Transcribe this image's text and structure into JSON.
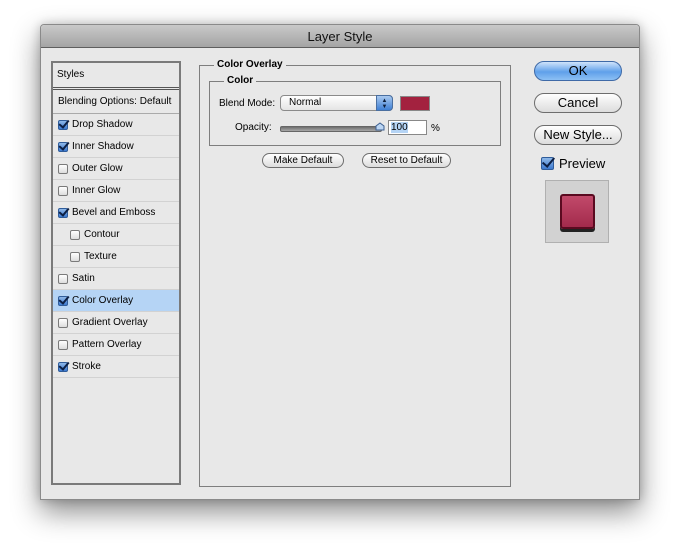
{
  "window": {
    "title": "Layer Style"
  },
  "styles_panel": {
    "header": "Styles",
    "blending_options": "Blending Options: Default",
    "items": [
      {
        "label": "Drop Shadow",
        "checked": true,
        "sub": false,
        "selected": false
      },
      {
        "label": "Inner Shadow",
        "checked": true,
        "sub": false,
        "selected": false
      },
      {
        "label": "Outer Glow",
        "checked": false,
        "sub": false,
        "selected": false
      },
      {
        "label": "Inner Glow",
        "checked": false,
        "sub": false,
        "selected": false
      },
      {
        "label": "Bevel and Emboss",
        "checked": true,
        "sub": false,
        "selected": false
      },
      {
        "label": "Contour",
        "checked": false,
        "sub": true,
        "selected": false
      },
      {
        "label": "Texture",
        "checked": false,
        "sub": true,
        "selected": false
      },
      {
        "label": "Satin",
        "checked": false,
        "sub": false,
        "selected": false
      },
      {
        "label": "Color Overlay",
        "checked": true,
        "sub": false,
        "selected": true
      },
      {
        "label": "Gradient Overlay",
        "checked": false,
        "sub": false,
        "selected": false
      },
      {
        "label": "Pattern Overlay",
        "checked": false,
        "sub": false,
        "selected": false
      },
      {
        "label": "Stroke",
        "checked": true,
        "sub": false,
        "selected": false
      }
    ]
  },
  "color_overlay": {
    "section_title": "Color Overlay",
    "group_title": "Color",
    "blend_mode_label": "Blend Mode:",
    "blend_mode_value": "Normal",
    "swatch_color": "#a3223f",
    "opacity_label": "Opacity:",
    "opacity_value": "100",
    "opacity_unit": "%",
    "opacity_percent": 100,
    "make_default": "Make Default",
    "reset_default": "Reset to Default"
  },
  "actions": {
    "ok": "OK",
    "cancel": "Cancel",
    "new_style": "New Style...",
    "preview_label": "Preview",
    "preview_checked": true
  }
}
